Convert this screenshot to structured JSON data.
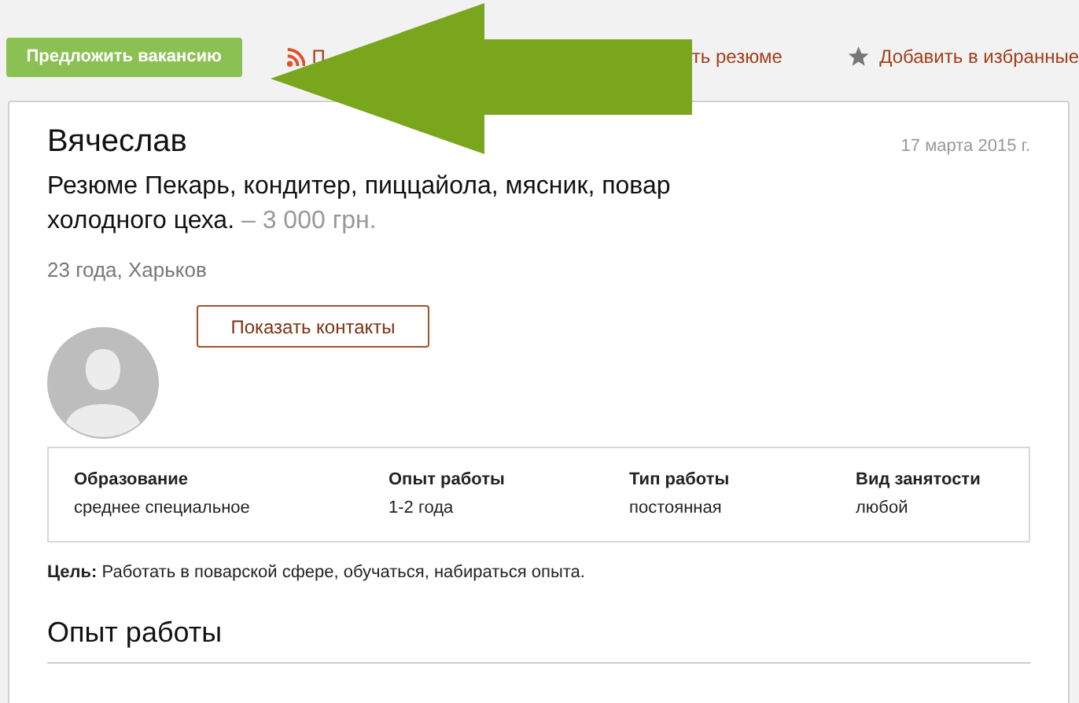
{
  "toolbar": {
    "offer_button": "Предложить вакансию",
    "rss_link": "П",
    "resume_link": "ть резюме",
    "favorite_link": "Добавить в избранные"
  },
  "resume": {
    "name": "Вячеслав",
    "date": "17 марта 2015 г.",
    "title": "Резюме Пекарь, кондитер, пиццайола, мясник, повар холодного цеха.",
    "salary": "– 3 000 грн.",
    "age_city": "23 года, Харьков",
    "contacts_button": "Показать контакты",
    "facts": [
      {
        "label": "Образование",
        "value": "среднее специальное"
      },
      {
        "label": "Опыт работы",
        "value": "1-2 года"
      },
      {
        "label": "Тип работы",
        "value": "постоянная"
      },
      {
        "label": "Вид занятости",
        "value": "любой"
      }
    ],
    "goal": "**Цель:** Работать в поварской сфере, обучаться, набираться опыта.",
    "section_heading": "Опыт работы"
  }
}
